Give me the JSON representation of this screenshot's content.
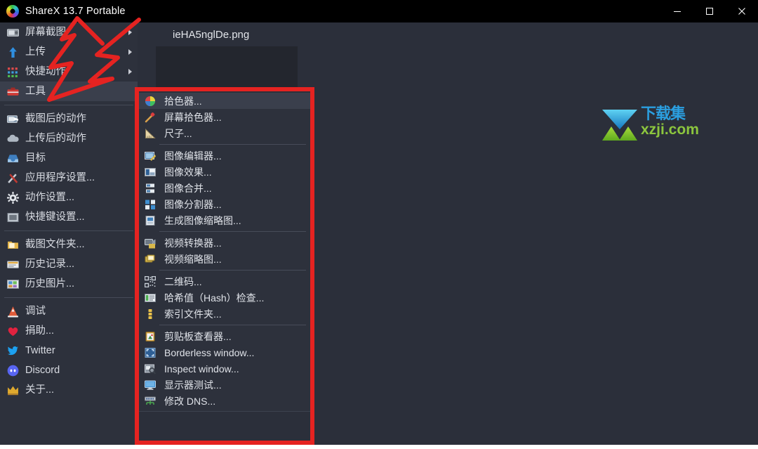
{
  "window": {
    "title": "ShareX 13.7 Portable",
    "logo_icon": "sharex-logo-icon",
    "controls": [
      {
        "name": "minimize-button",
        "glyph": "minimize-icon"
      },
      {
        "name": "maximize-button",
        "glyph": "maximize-icon"
      },
      {
        "name": "close-button",
        "glyph": "close-icon"
      }
    ]
  },
  "sidebar": {
    "groups": [
      {
        "items": [
          {
            "label": "屏幕截图",
            "icon": "camera-icon",
            "submenu": true,
            "selected": false
          },
          {
            "label": "上传",
            "icon": "upload-arrow-icon",
            "submenu": true,
            "selected": false
          },
          {
            "label": "快捷动作",
            "icon": "dots-grid-icon",
            "submenu": true,
            "selected": false
          },
          {
            "label": "工具",
            "icon": "toolbox-icon",
            "submenu": false,
            "selected": true
          }
        ]
      },
      {
        "items": [
          {
            "label": "截图后的动作",
            "icon": "after-capture-icon",
            "submenu": false,
            "selected": false
          },
          {
            "label": "上传后的动作",
            "icon": "cloud-icon",
            "submenu": false,
            "selected": false
          },
          {
            "label": "目标",
            "icon": "destination-inbox-icon",
            "submenu": false,
            "selected": false
          },
          {
            "label": "应用程序设置...",
            "icon": "wrench-screwdriver-icon",
            "submenu": false,
            "selected": false
          },
          {
            "label": "动作设置...",
            "icon": "gear-icon",
            "submenu": false,
            "selected": false
          },
          {
            "label": "快捷键设置...",
            "icon": "keyboard-icon",
            "submenu": false,
            "selected": false
          }
        ]
      },
      {
        "items": [
          {
            "label": "截图文件夹...",
            "icon": "folder-icon",
            "submenu": false,
            "selected": false
          },
          {
            "label": "历史记录...",
            "icon": "history-list-icon",
            "submenu": false,
            "selected": false
          },
          {
            "label": "历史图片...",
            "icon": "image-history-icon",
            "submenu": false,
            "selected": false
          }
        ]
      },
      {
        "items": [
          {
            "label": "调试",
            "icon": "debug-cone-icon",
            "submenu": false,
            "selected": false
          },
          {
            "label": "捐助...",
            "icon": "heart-icon",
            "submenu": false,
            "selected": false
          },
          {
            "label": "Twitter",
            "icon": "twitter-bird-icon",
            "submenu": false,
            "selected": false
          },
          {
            "label": "Discord",
            "icon": "discord-icon",
            "submenu": false,
            "selected": false
          },
          {
            "label": "关于...",
            "icon": "crown-icon",
            "submenu": false,
            "selected": false
          }
        ]
      }
    ]
  },
  "content": {
    "file_name": "ieHA5nglDe.png",
    "thumbnail_placeholder": ""
  },
  "context_menu": {
    "groups": [
      {
        "items": [
          {
            "label": "拾色器...",
            "icon": "color-wheel-icon",
            "hovered": true
          },
          {
            "label": "屏幕拾色器...",
            "icon": "eyedropper-icon",
            "hovered": false
          },
          {
            "label": "尺子...",
            "icon": "ruler-icon",
            "hovered": false
          }
        ]
      },
      {
        "items": [
          {
            "label": "图像编辑器...",
            "icon": "image-editor-icon",
            "hovered": false
          },
          {
            "label": "图像效果...",
            "icon": "image-effects-icon",
            "hovered": false
          },
          {
            "label": "图像合并...",
            "icon": "image-combiner-icon",
            "hovered": false
          },
          {
            "label": "图像分割器...",
            "icon": "image-splitter-icon",
            "hovered": false
          },
          {
            "label": "生成图像缩略图...",
            "icon": "image-thumbnailer-icon",
            "hovered": false
          }
        ]
      },
      {
        "items": [
          {
            "label": "视频转换器...",
            "icon": "video-converter-icon",
            "hovered": false
          },
          {
            "label": "视频缩略图...",
            "icon": "video-thumbnailer-icon",
            "hovered": false
          }
        ]
      },
      {
        "items": [
          {
            "label": "二维码...",
            "icon": "qr-code-icon",
            "hovered": false
          },
          {
            "label": "哈希值（Hash）检查...",
            "icon": "hash-check-icon",
            "hovered": false
          },
          {
            "label": "索引文件夹...",
            "icon": "index-folder-icon",
            "hovered": false
          }
        ]
      },
      {
        "items": [
          {
            "label": "剪贴板查看器...",
            "icon": "clipboard-viewer-icon",
            "hovered": false
          },
          {
            "label": "Borderless window...",
            "icon": "borderless-window-icon",
            "hovered": false
          },
          {
            "label": "Inspect window...",
            "icon": "inspect-window-icon",
            "hovered": false
          },
          {
            "label": "显示器测试...",
            "icon": "monitor-test-icon",
            "hovered": false
          },
          {
            "label": "修改 DNS...",
            "icon": "dns-changer-icon",
            "hovered": false
          }
        ]
      }
    ]
  },
  "watermark": {
    "text_top": "下载集",
    "text_bottom": "xzji.com",
    "color_top": "#2b9fe0",
    "color_bottom": "#8cc63e"
  },
  "annotations": {
    "rect_color": "#e52321",
    "arrow_color": "#e52321"
  },
  "colors": {
    "titlebar_bg": "#000000",
    "window_bg": "#2b2f3a",
    "sidebar_bg": "#2d313c",
    "menu_bg": "#2d313c",
    "highlight_bg": "#3a3f4c",
    "text": "#dfe2e8"
  }
}
